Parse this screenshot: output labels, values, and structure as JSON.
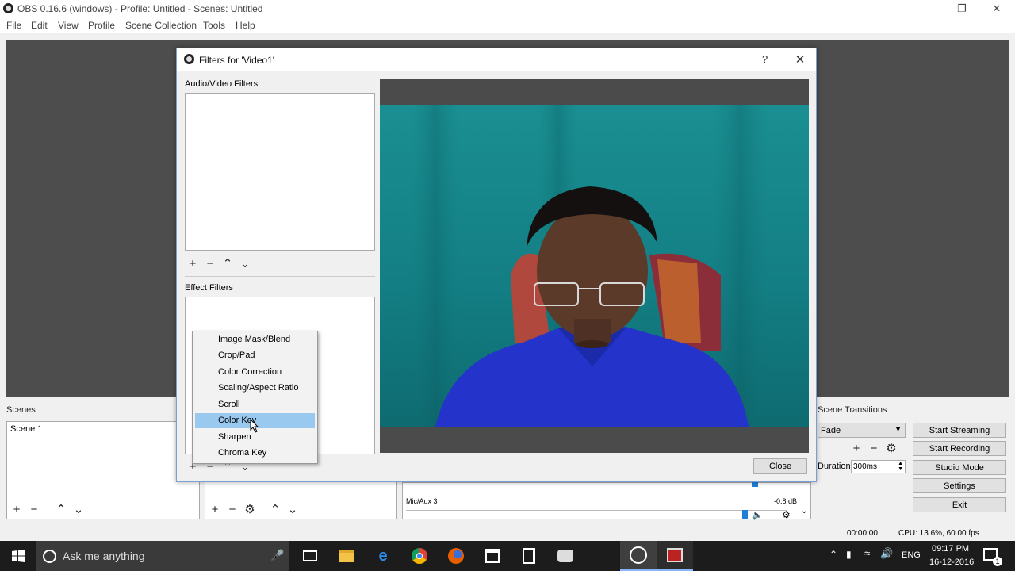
{
  "window": {
    "title": "OBS 0.16.6 (windows) - Profile: Untitled - Scenes: Untitled"
  },
  "menu": [
    "File",
    "Edit",
    "View",
    "Profile",
    "Scene Collection",
    "Tools",
    "Help"
  ],
  "docks": {
    "scenes": {
      "title": "Scenes",
      "items": [
        "Scene 1"
      ]
    },
    "mixer": {
      "channel": "Mic/Aux 3",
      "level": "-0.8 dB"
    },
    "transitions": {
      "title": "Scene Transitions",
      "selected": "Fade",
      "duration_label": "Duration",
      "duration_value": "300ms"
    }
  },
  "controls": [
    "Start Streaming",
    "Start Recording",
    "Studio Mode",
    "Settings",
    "Exit"
  ],
  "statusbar": {
    "time": "00:00:00",
    "cpu": "CPU: 13.6%, 60.00 fps"
  },
  "dialog": {
    "title": "Filters for 'Video1'",
    "help": "?",
    "av_filters_label": "Audio/Video Filters",
    "effect_filters_label": "Effect Filters",
    "close_label": "Close",
    "context_menu": [
      "Image Mask/Blend",
      "Crop/Pad",
      "Color Correction",
      "Scaling/Aspect Ratio",
      "Scroll",
      "Color Key",
      "Sharpen",
      "Chroma Key"
    ],
    "context_menu_selected": "Color Key"
  },
  "taskbar": {
    "search_placeholder": "Ask me anything",
    "lang": "ENG",
    "clock_time": "09:17 PM",
    "clock_date": "16-12-2016",
    "notifications": "1"
  },
  "colors": {
    "highlight": "#99c9ef",
    "preview_bg": "#4d4d4d",
    "taskbar_bg": "#1c1c1c",
    "wall": "#1a8f92",
    "shirt": "#2433c9"
  }
}
